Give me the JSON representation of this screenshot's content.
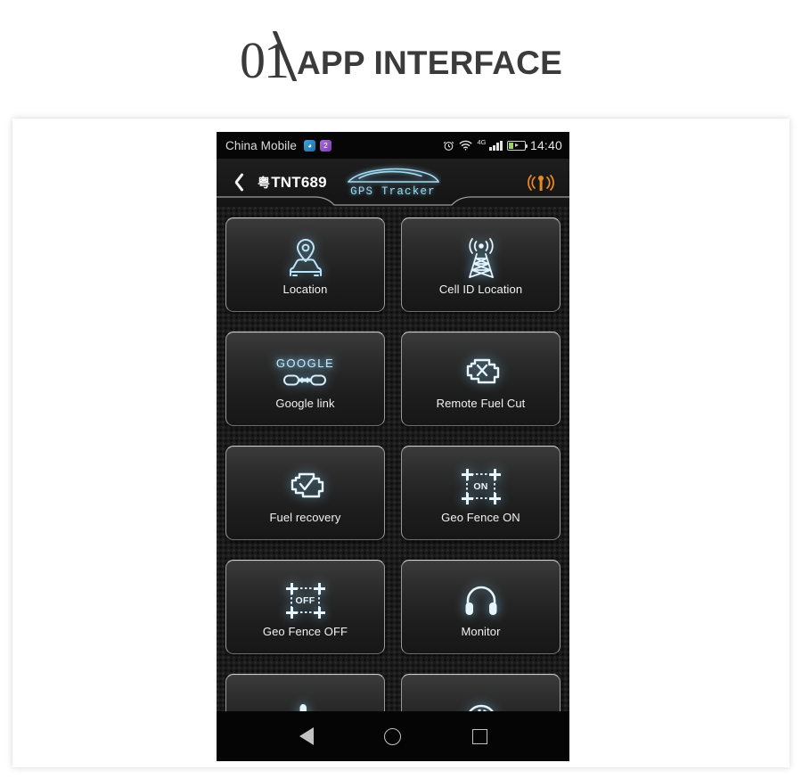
{
  "heading": {
    "number": "01",
    "title": "APP INTERFACE"
  },
  "phone": {
    "status_bar": {
      "carrier": "China Mobile",
      "app_icon_1": "messaging-icon",
      "app_icon_2": "app-badge-icon",
      "alarm_icon": "alarm-clock-icon",
      "wifi_icon": "wifi-icon",
      "network_label": "4G",
      "signal_icon": "signal-bars-icon",
      "battery_icon": "battery-charging-icon",
      "clock": "14:40"
    },
    "header": {
      "back_icon": "back-chevron-icon",
      "plate_prefix": "粤",
      "plate_number": "TNT689",
      "logo_car_icon": "car-outline-icon",
      "brand_name": "GPS Tracker",
      "antenna_icon": "antenna-signal-icon",
      "antenna_color": "#e8881f",
      "accent_color": "#9fd8ef"
    },
    "tiles": [
      {
        "label": "Location",
        "icon": "map-pin-car-icon",
        "name": "tile-location"
      },
      {
        "label": "Cell ID Location",
        "icon": "cell-tower-icon",
        "name": "tile-cell-id-location"
      },
      {
        "label": "Google link",
        "icon": "chain-link-icon",
        "name": "tile-google-link",
        "glow_text": "GOOGLE"
      },
      {
        "label": "Remote Fuel Cut",
        "icon": "engine-cross-icon",
        "name": "tile-remote-fuel-cut"
      },
      {
        "label": "Fuel recovery",
        "icon": "engine-check-icon",
        "name": "tile-fuel-recovery"
      },
      {
        "label": "Geo Fence ON",
        "icon": "geofence-icon",
        "name": "tile-geo-fence-on",
        "fence_text": "ON"
      },
      {
        "label": "Geo Fence OFF",
        "icon": "geofence-icon",
        "name": "tile-geo-fence-off",
        "fence_text": "OFF"
      },
      {
        "label": "Monitor",
        "icon": "headphones-icon",
        "name": "tile-monitor"
      },
      {
        "label": "",
        "icon": "hand-touch-icon",
        "name": "tile-partial-left"
      },
      {
        "label": "",
        "icon": "speedometer-icon",
        "name": "tile-partial-right"
      }
    ],
    "nav_bar": {
      "back": "nav-back-icon",
      "home": "nav-home-icon",
      "recents": "nav-recents-icon"
    }
  }
}
